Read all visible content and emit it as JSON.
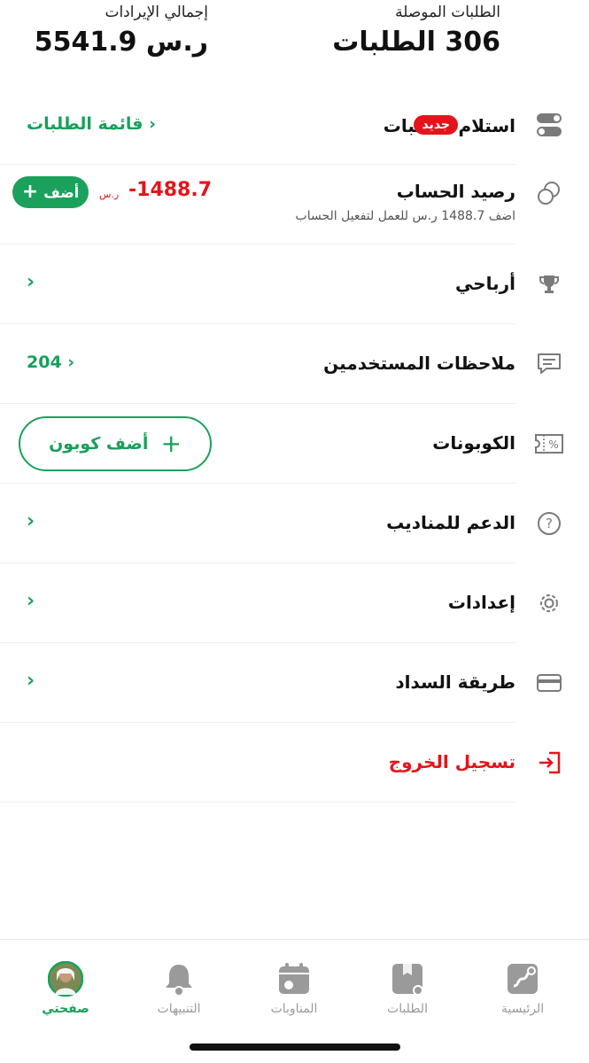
{
  "stats": {
    "delivered_label": "الطلبات الموصلة",
    "delivered_value": "306 الطلبات",
    "revenue_label": "إجمالي الإيرادات",
    "revenue_value": "5541.9  ر.س"
  },
  "orders": {
    "title": "استلام الطلبات",
    "badge": "جديد",
    "link": "قائمة الطلبات"
  },
  "balance": {
    "title": "رصيد الحساب",
    "amount": "-1488.7",
    "currency": "ر.س",
    "note": "اضف  1488.7  ر.س للعمل لتفعيل الحساب",
    "add_label": "أضف"
  },
  "profits": {
    "title": "أرباحي"
  },
  "feedback": {
    "title": "ملاحظات المستخدمين",
    "count": "204"
  },
  "coupons": {
    "title": "الكوبونات",
    "add_label": "أضف كوبون"
  },
  "support": {
    "title": "الدعم للمناديب"
  },
  "settings": {
    "title": "إعدادات"
  },
  "payment": {
    "title": "طريقة السداد"
  },
  "logout": {
    "title": "تسجيل الخروج"
  },
  "nav": {
    "home": "الرئيسية",
    "orders": "الطلبات",
    "shifts": "المناوبات",
    "alerts": "التنبيهات",
    "profile": "صفحتي"
  },
  "colors": {
    "accent": "#1a9f5b",
    "danger": "#e5141c"
  }
}
